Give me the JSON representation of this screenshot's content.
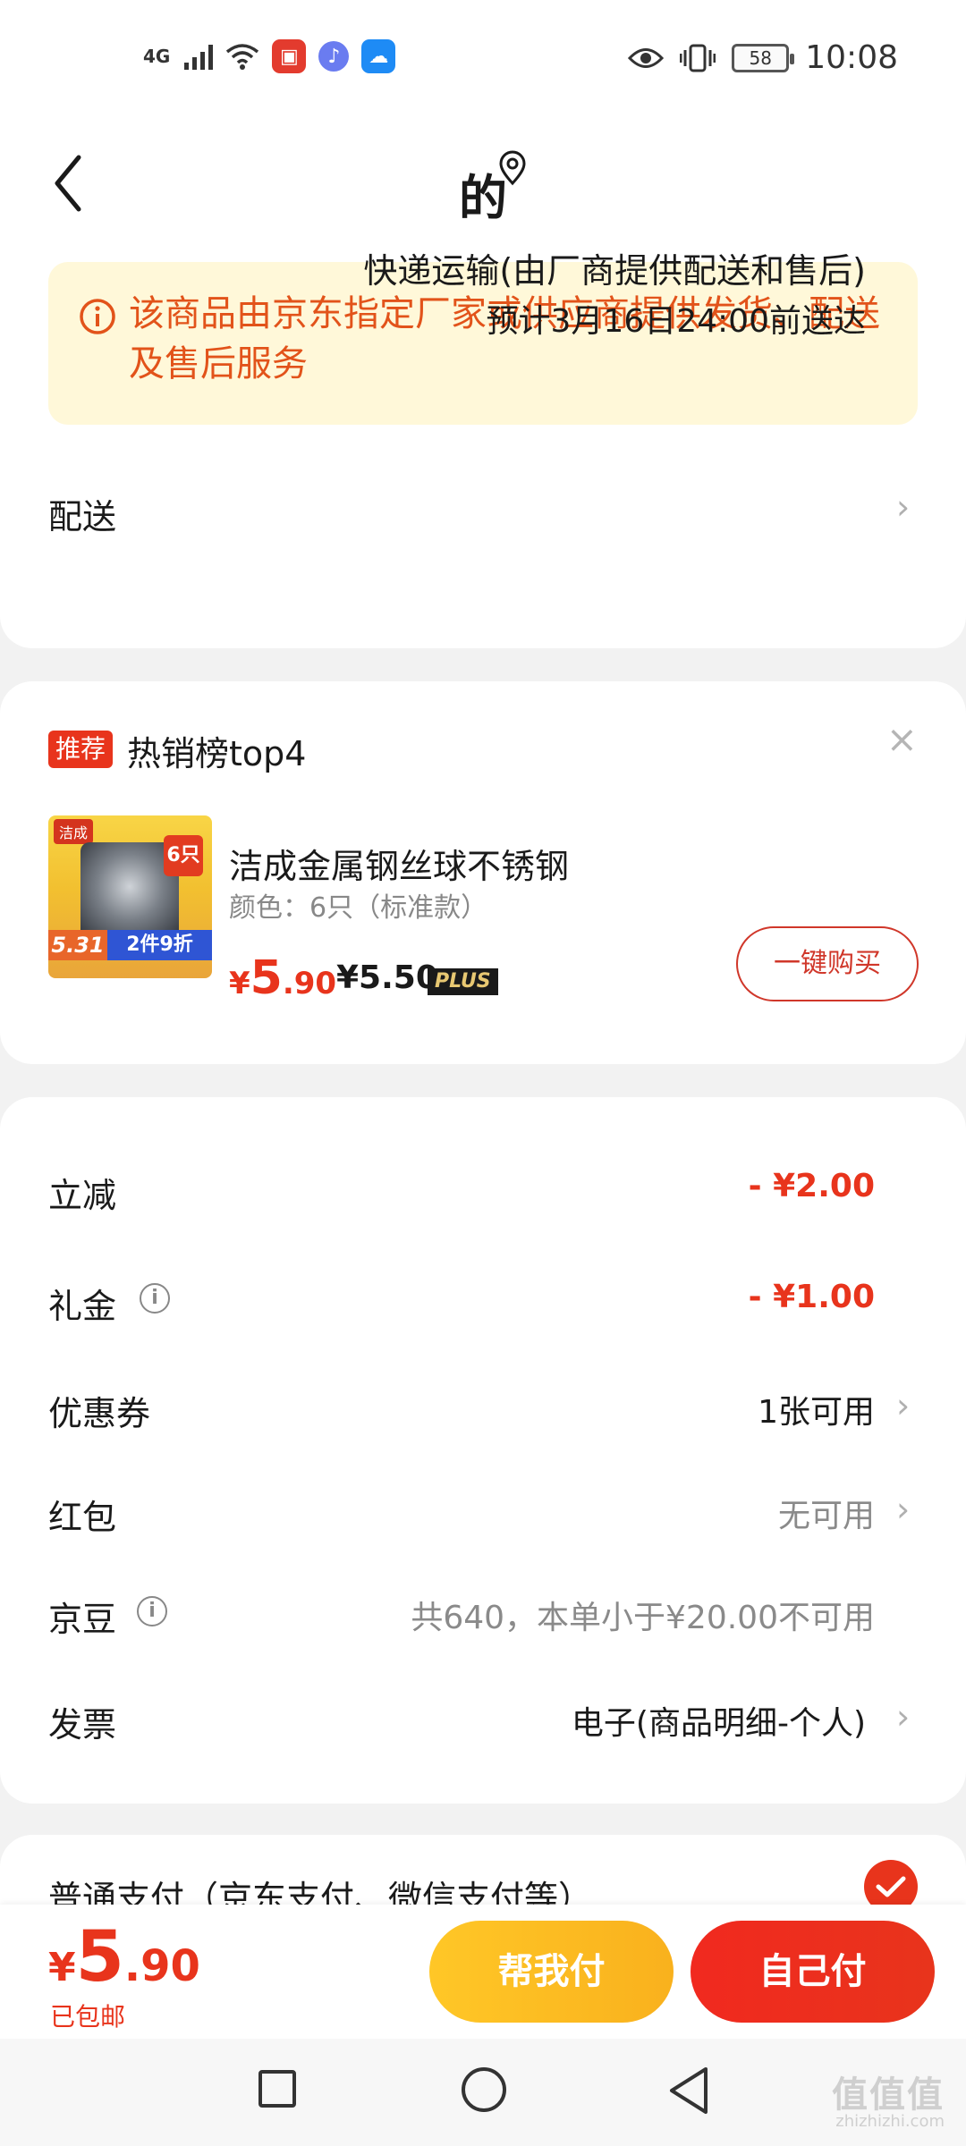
{
  "status_bar": {
    "network": "4G",
    "battery": "58",
    "time": "10:08"
  },
  "header": {
    "title": "的"
  },
  "notice": {
    "text": "该商品由京东指定厂家或供应商提供发货、配送及售后服务"
  },
  "delivery": {
    "label": "配送",
    "method": "快递运输(由厂商提供配送和售后)",
    "eta": "预计3月16日24:00前送达"
  },
  "recommend": {
    "tag": "推荐",
    "title": "热销榜top4",
    "product": {
      "brand": "洁成",
      "pack_badge": "6只",
      "badge_price": "5.31",
      "badge_promo": "2件9折",
      "name": "洁成金属钢丝球不锈钢",
      "spec": "颜色：6只（标准款）",
      "price_currency": "¥",
      "price_int": "5",
      "price_dec": ".90",
      "plus_price": "¥5.50",
      "plus_label": "PLUS",
      "buy_label": "一键购买"
    }
  },
  "discounts": {
    "instant": {
      "label": "立减",
      "value": "- ¥2.00"
    },
    "gift": {
      "label": "礼金",
      "value": "- ¥1.00"
    },
    "coupon": {
      "label": "优惠券",
      "value": "1张可用"
    },
    "redpacket": {
      "label": "红包",
      "value": "无可用"
    },
    "jingdou": {
      "label": "京豆",
      "value": "共640，本单小于¥20.00不可用"
    },
    "invoice": {
      "label": "发票",
      "value": "电子(商品明细-个人)"
    }
  },
  "payment": {
    "method": "普通支付（京东支付、微信支付等）"
  },
  "bottom": {
    "currency": "¥",
    "total_int": "5",
    "total_dec": ".90",
    "shipping": "已包邮",
    "help_pay": "帮我付",
    "self_pay": "自己付"
  },
  "watermark": {
    "text": "值值值",
    "sub": "zhizhizhi.com"
  },
  "colors": {
    "accent_red": "#e8341c",
    "notice_bg": "#fff8d9",
    "notice_text": "#e2531a",
    "help_yellow": "#ffc727"
  }
}
